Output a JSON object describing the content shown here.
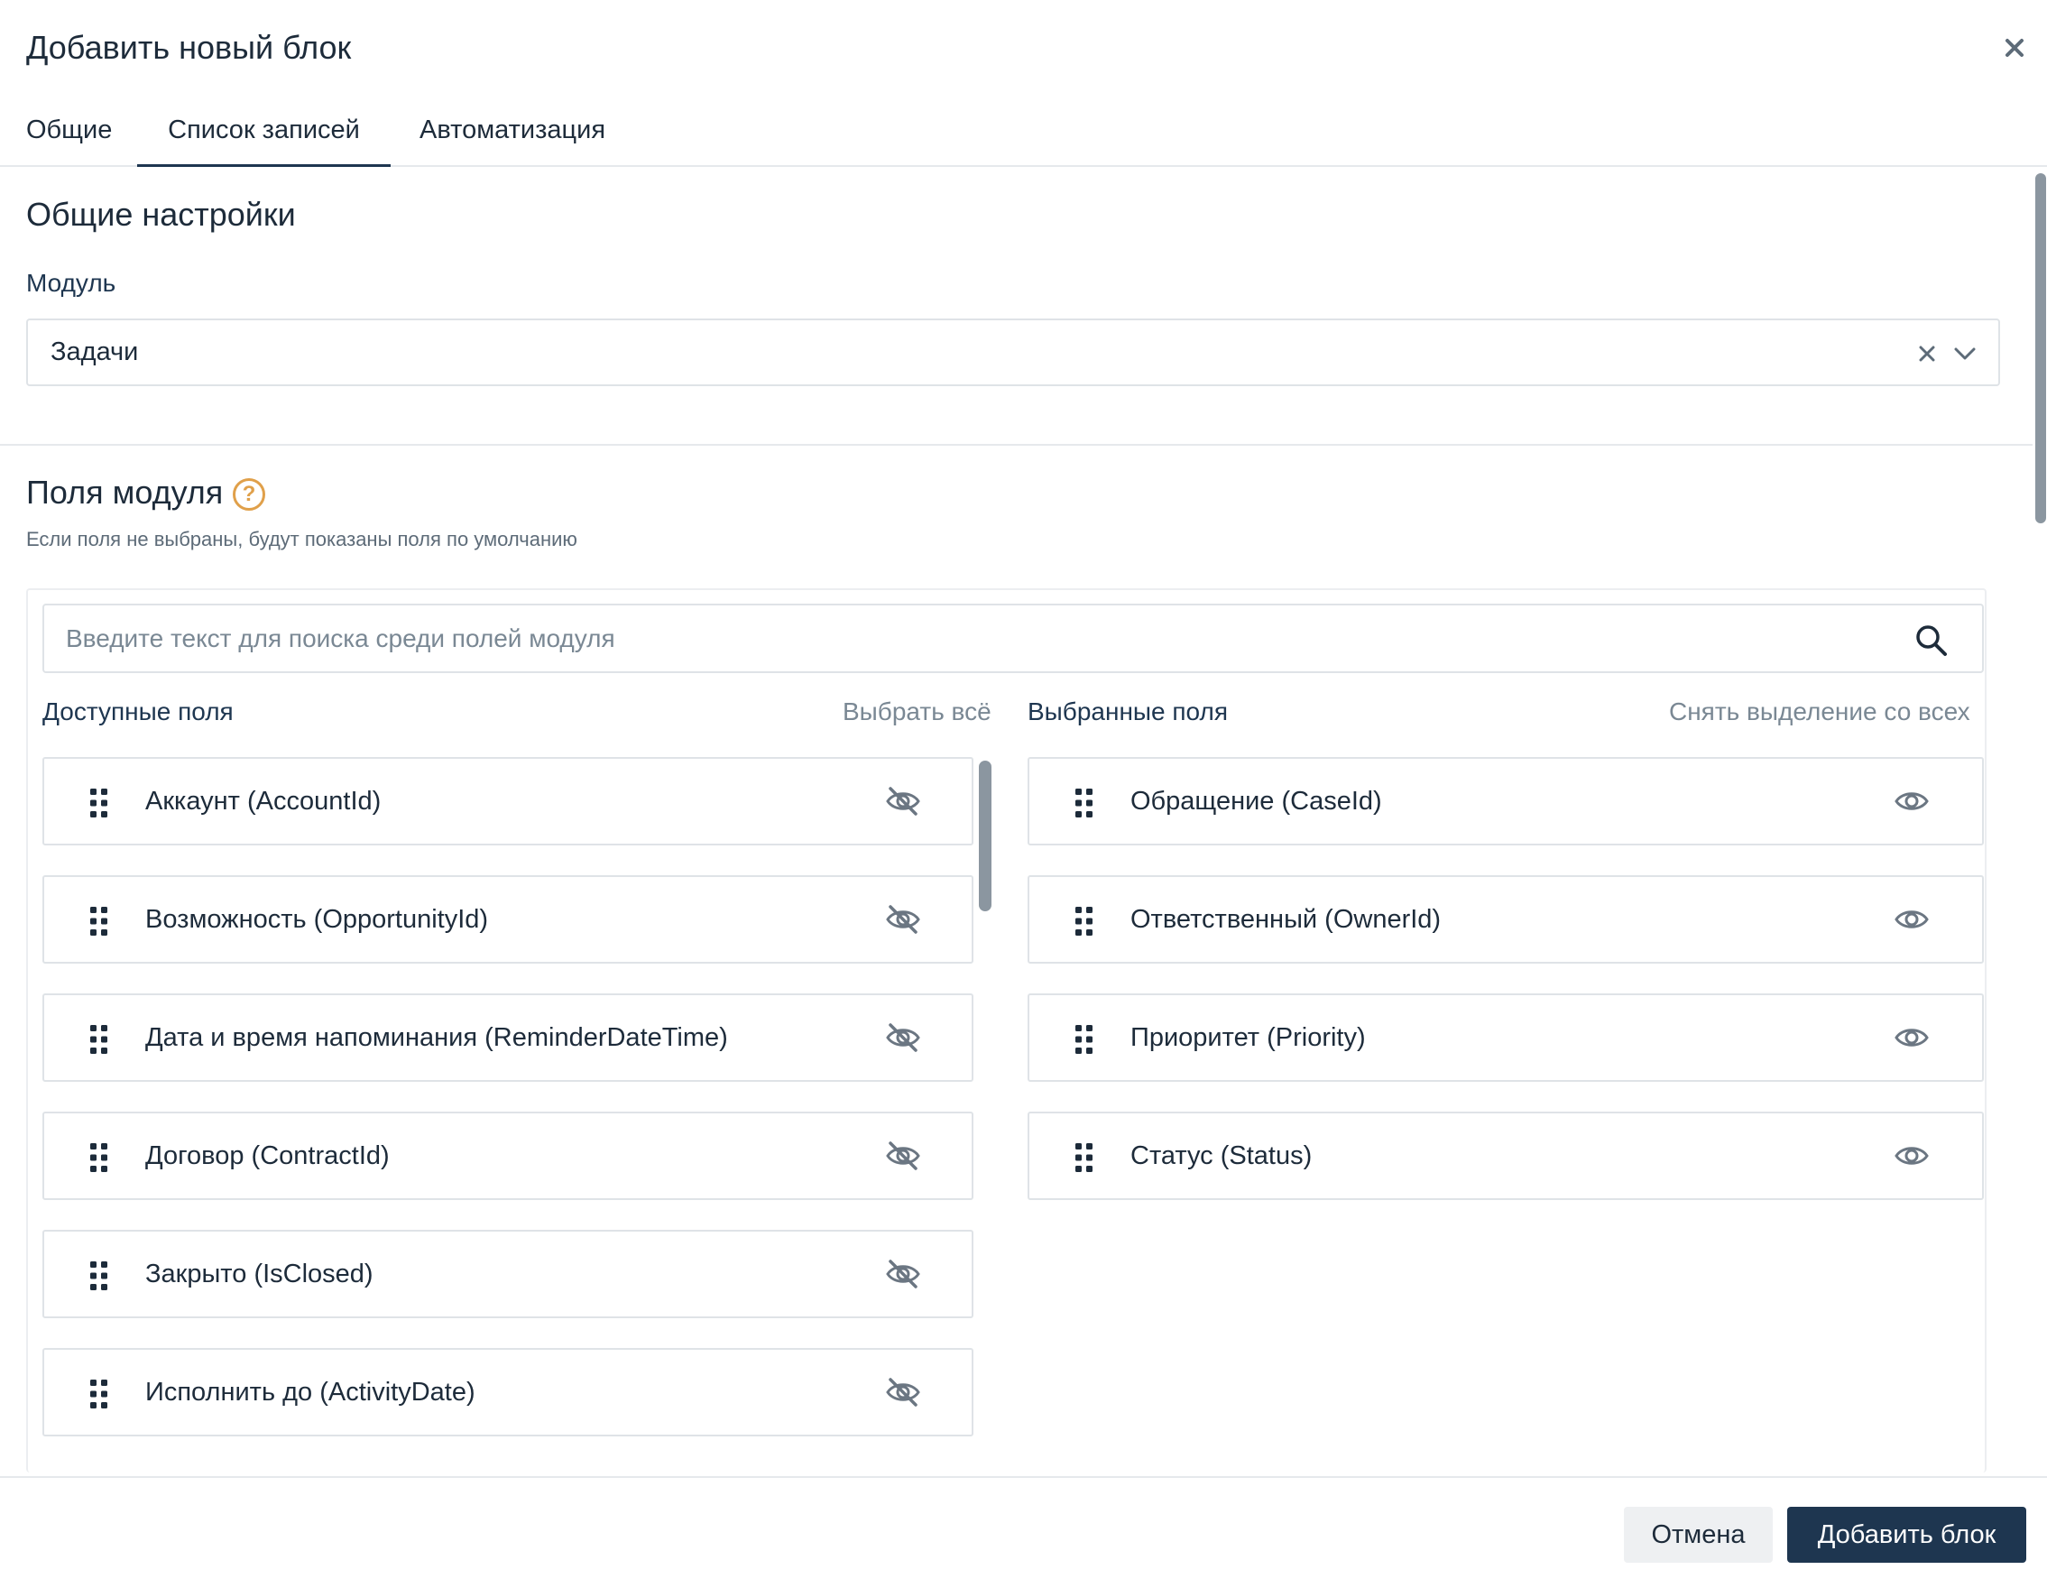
{
  "dialog": {
    "title": "Добавить новый блок"
  },
  "tabs": [
    {
      "label": "Общие",
      "active": false
    },
    {
      "label": "Список записей",
      "active": true
    },
    {
      "label": "Автоматизация",
      "active": false
    }
  ],
  "general": {
    "section_title": "Общие настройки",
    "module_label": "Модуль",
    "module_value": "Задачи"
  },
  "fields": {
    "section_title": "Поля модуля",
    "hint": "Если поля не выбраны, будут показаны поля по умолчанию",
    "search_placeholder": "Введите текст для поиска среди полей модуля",
    "available_title": "Доступные поля",
    "select_all": "Выбрать всё",
    "selected_title": "Выбранные поля",
    "deselect_all": "Снять выделение со всех",
    "available": [
      {
        "label": "Аккаунт (AccountId)",
        "icon": "eye-off-icon"
      },
      {
        "label": "Возможность (OpportunityId)",
        "icon": "eye-off-icon"
      },
      {
        "label": "Дата и время напоминания (ReminderDateTime)",
        "icon": "eye-off-icon"
      },
      {
        "label": "Договор (ContractId)",
        "icon": "eye-off-icon"
      },
      {
        "label": "Закрыто (IsClosed)",
        "icon": "eye-off-icon"
      },
      {
        "label": "Исполнить до (ActivityDate)",
        "icon": "eye-off-icon"
      }
    ],
    "selected": [
      {
        "label": "Обращение (CaseId)",
        "icon": "eye-icon"
      },
      {
        "label": "Ответственный (OwnerId)",
        "icon": "eye-icon"
      },
      {
        "label": "Приоритет (Priority)",
        "icon": "eye-icon"
      },
      {
        "label": "Статус (Status)",
        "icon": "eye-icon"
      }
    ]
  },
  "footer": {
    "cancel_label": "Отмена",
    "submit_label": "Добавить блок"
  },
  "colors": {
    "primary": "#1e3650",
    "help_accent": "#e0a04a",
    "border": "#dfe3e7"
  }
}
